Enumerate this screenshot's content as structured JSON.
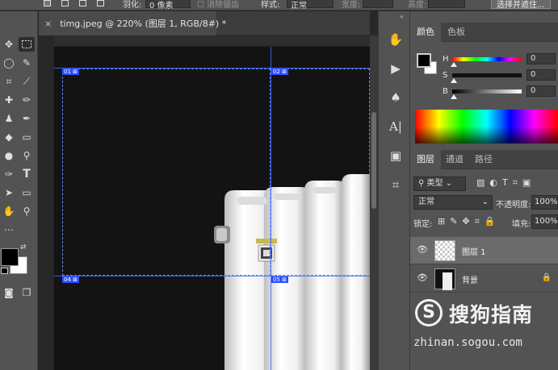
{
  "options_bar": {
    "feather_label": "羽化:",
    "feather_value": "0 像素",
    "antialias_label": "消除锯齿",
    "style_label": "样式:",
    "style_value": "正常",
    "width_label": "宽度:",
    "height_label": "高度:",
    "select_subject_button": "选择并遮住..."
  },
  "document": {
    "tab_title": "timg.jpeg @ 220% (图层 1, RGB/8#) *",
    "slice_labels": [
      "01",
      "02",
      "04",
      "05"
    ]
  },
  "color_panel": {
    "tabs": [
      "颜色",
      "色板"
    ],
    "active_tab": "颜色",
    "channels": [
      {
        "label": "H",
        "value": "0"
      },
      {
        "label": "S",
        "value": "0"
      },
      {
        "label": "B",
        "value": "0"
      }
    ],
    "foreground": "#000000",
    "background": "#ffffff"
  },
  "layers_panel": {
    "tabs": [
      "图层",
      "通道",
      "路径"
    ],
    "active_tab": "图层",
    "filter_label": "类型",
    "blend_mode": "正常",
    "opacity_label": "不透明度:",
    "opacity_value": "100%",
    "lock_label": "锁定:",
    "fill_label": "填充:",
    "fill_value": "100%",
    "layers": [
      {
        "name": "图层 1",
        "selected": true
      },
      {
        "name": "背景",
        "selected": false,
        "locked": true
      }
    ]
  },
  "watermark": {
    "brand": "搜狗指南",
    "url": "zhinan.sogou.com",
    "logo_letter": "S"
  },
  "colors": {
    "panel_bg": "#535353",
    "guide_blue": "#3b6cff",
    "slice_label_bg": "#2d4bff"
  }
}
